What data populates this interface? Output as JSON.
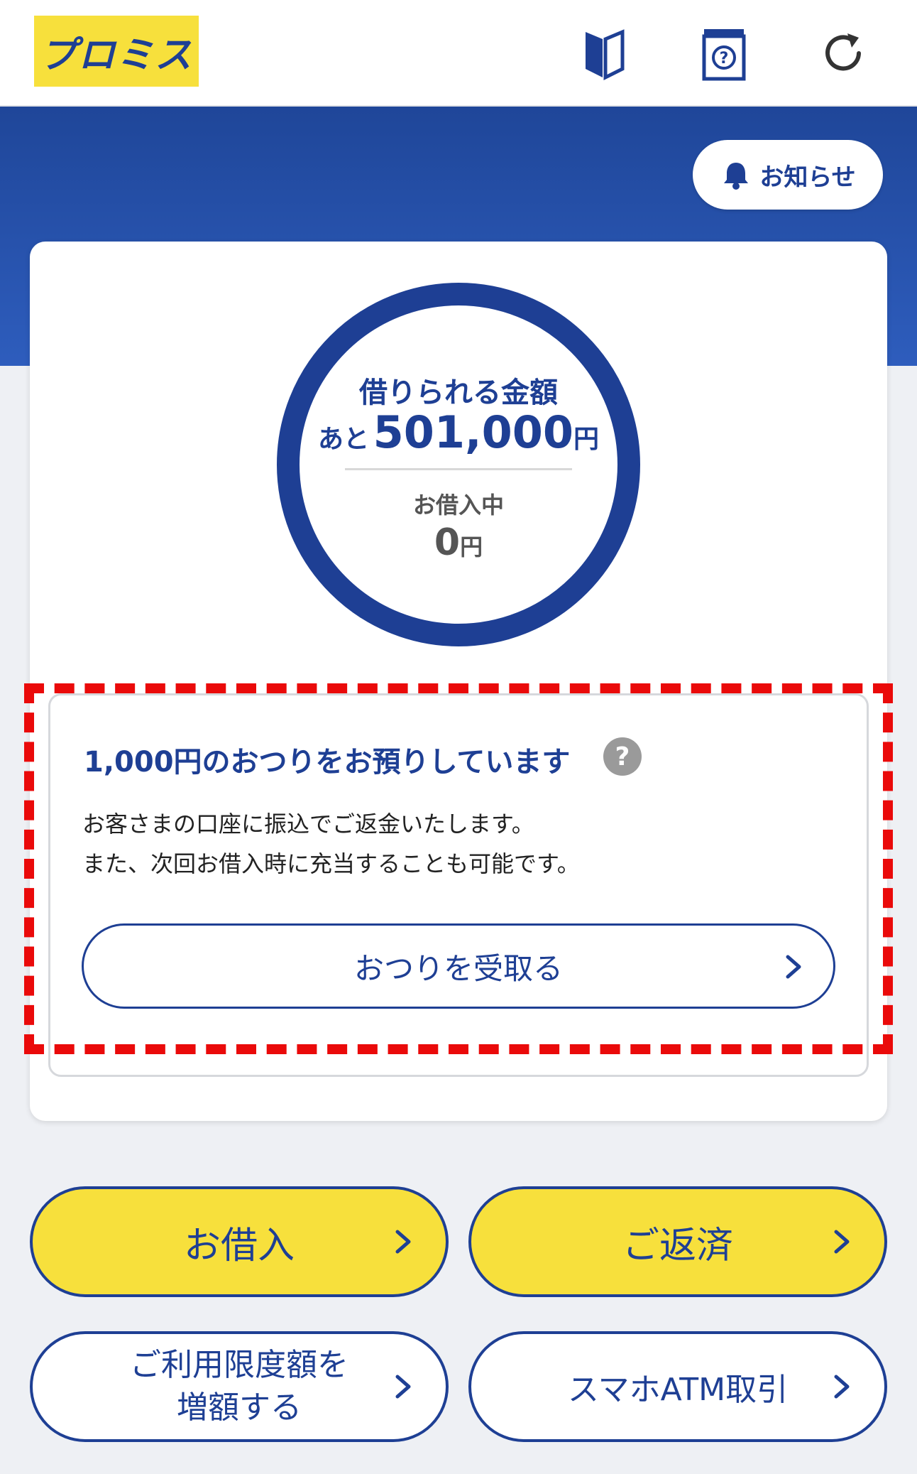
{
  "header": {
    "logo_text": "プロミス",
    "icons": [
      "beginner-mark-icon",
      "help-book-icon",
      "refresh-icon"
    ]
  },
  "notice": {
    "label": "お知らせ"
  },
  "summary": {
    "available_title": "借りられる金額",
    "available_prefix": "あと",
    "available_amount": "501,000",
    "available_unit": "円",
    "borrowing_label": "お借入中",
    "borrowing_amount": "0",
    "borrowing_unit": "円"
  },
  "change": {
    "title": "1,000円のおつりをお預りしています",
    "help_glyph": "?",
    "desc_line1": "お客さまの口座に振込でご返金いたします。",
    "desc_line2": "また、次回お借入時に充当することも可能です。",
    "receive_button": "おつりを受取る"
  },
  "actions": {
    "borrow": "お借入",
    "repay": "ご返済",
    "increase_line1": "ご利用限度額を",
    "increase_line2": "増額する",
    "smartphone_atm": "スマホATM取引"
  },
  "colors": {
    "brand_blue": "#1e3f94",
    "brand_yellow": "#f7e03c",
    "highlight_red": "#ea0a0a"
  }
}
